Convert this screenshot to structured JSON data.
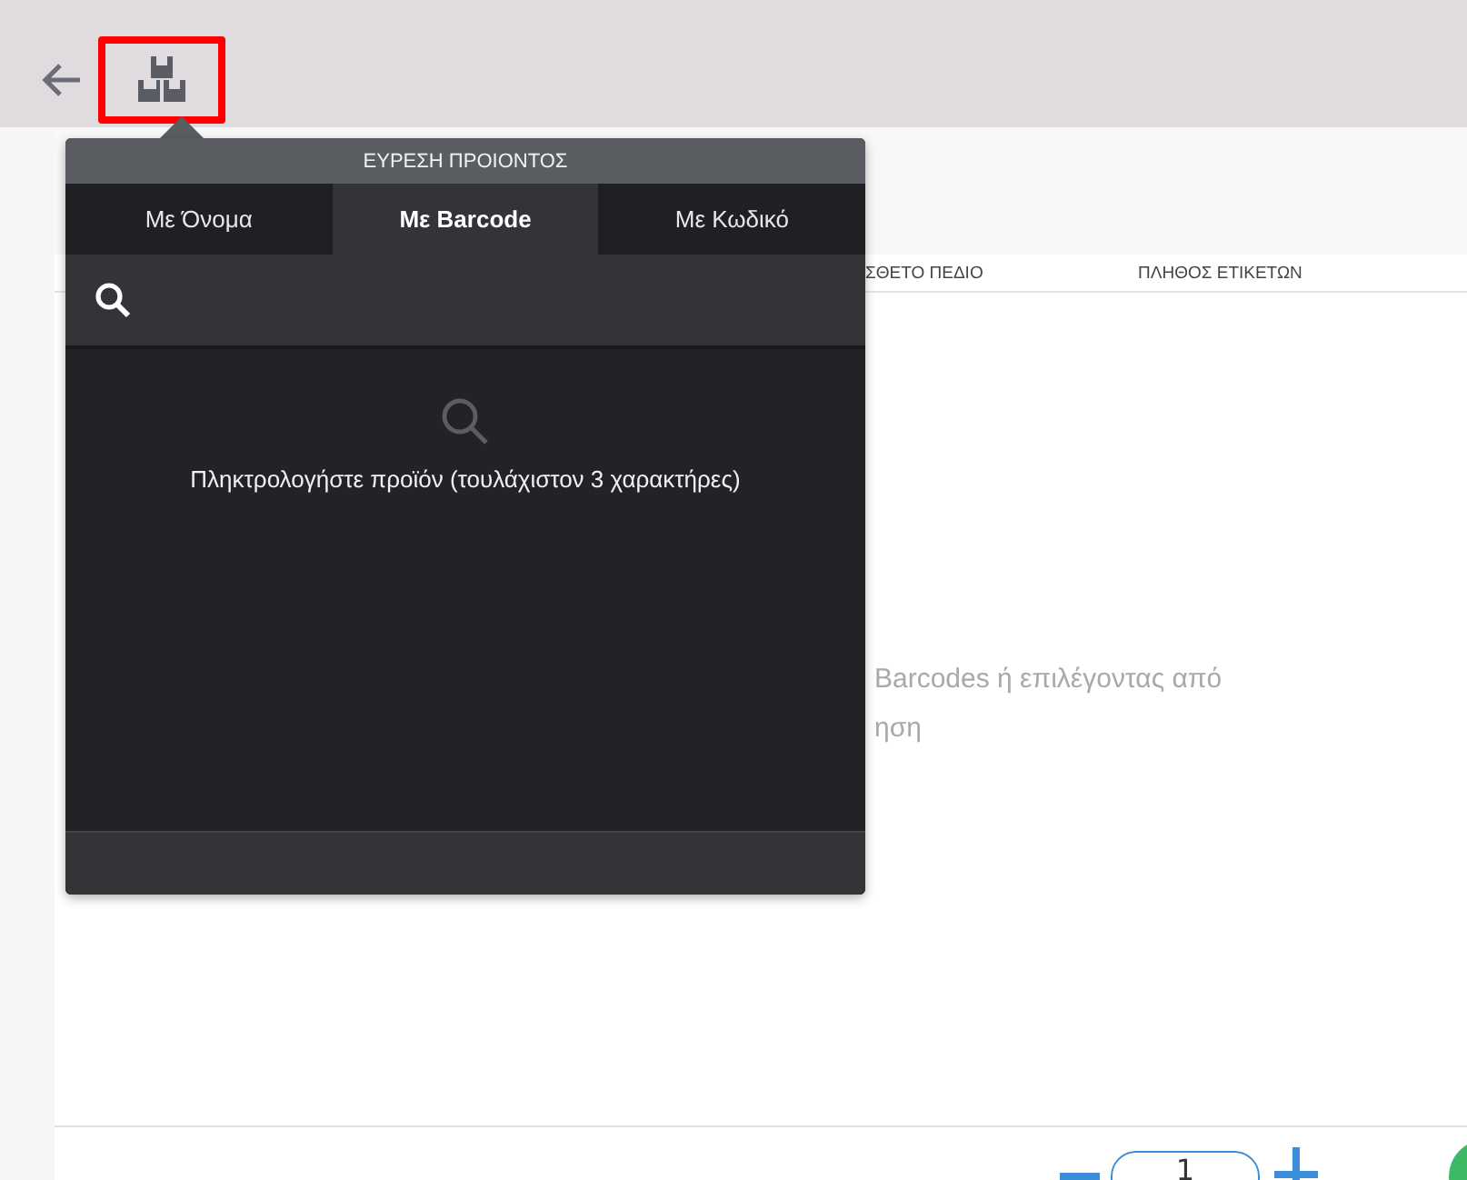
{
  "page": {
    "columns": [
      "ΣΘΕΤΟ ΠΕΔΙΟ",
      "ΠΛΗΘΟΣ ΕΤΙΚΕΤΩΝ"
    ],
    "empty_lines": [
      "Barcodes ή επιλέγοντας από",
      "ηση"
    ]
  },
  "popup": {
    "title": "ΕΥΡΕΣΗ ΠΡΟΙΟΝΤΟΣ",
    "tabs": [
      {
        "label": "Με Όνομα",
        "selected": false
      },
      {
        "label": "Με Barcode",
        "selected": true
      },
      {
        "label": "Με Κωδικό",
        "selected": false
      }
    ],
    "message": "Πληκτρολογήστε προϊόν (τουλάχιστον 3 χαρακτήρες)"
  },
  "footer": {
    "quantity": "1"
  }
}
